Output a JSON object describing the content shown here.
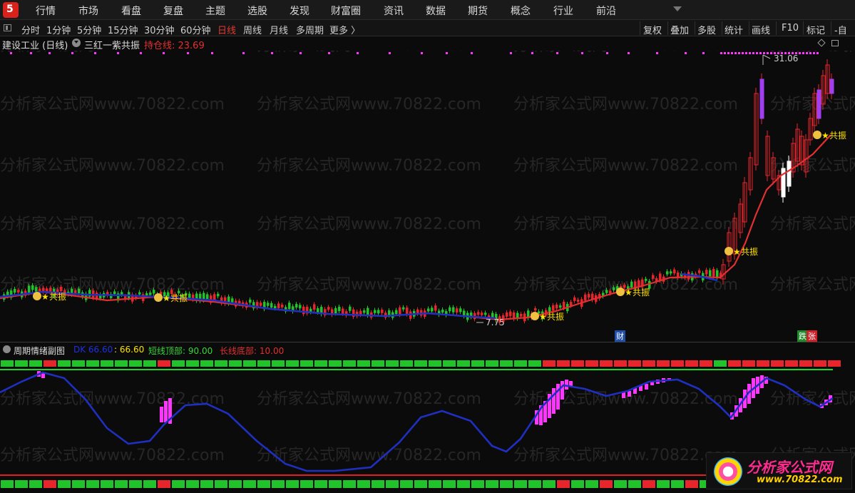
{
  "nav": {
    "items": [
      "行情",
      "市场",
      "看盘",
      "复盘",
      "主题",
      "选股",
      "发现",
      "财富圈",
      "资讯",
      "数据",
      "期货",
      "概念",
      "行业",
      "前沿"
    ]
  },
  "periods": {
    "items": [
      "分时",
      "1分钟",
      "5分钟",
      "15分钟",
      "30分钟",
      "60分钟",
      "日线",
      "周线",
      "月线",
      "多周期",
      "更多 〉"
    ],
    "active": "日线",
    "right": [
      "复权",
      "叠加",
      "多股",
      "统计",
      "画线",
      "F10",
      "标记",
      "-自"
    ]
  },
  "main_header": {
    "title": "建设工业 (日线)",
    "indicator": "三红一紫共振",
    "hold_label": "持仓线: 23.69"
  },
  "price_labels": {
    "high": "31.06",
    "low": "7.75"
  },
  "badges": {
    "cai": "财",
    "die": "跌",
    "zhang": "张"
  },
  "signal_label": "共振",
  "sub_header": {
    "title": "周期情绪副图",
    "dk": "DK 66.60",
    "colon_value": ": 66.60",
    "short_top": "短线顶部: 90.00",
    "long_bottom": "长线底部: 10.00"
  },
  "watermark_text": "分析家公式网www.70822.com",
  "logo": {
    "line1": "分析家公式网",
    "line2": "www.70822.com"
  },
  "colors": {
    "up": "#e8252b",
    "down": "#22c32a",
    "purple": "#ff36ff",
    "blue": "#1f2fbf",
    "hold": "#e23030",
    "star": "#ffe100"
  }
}
